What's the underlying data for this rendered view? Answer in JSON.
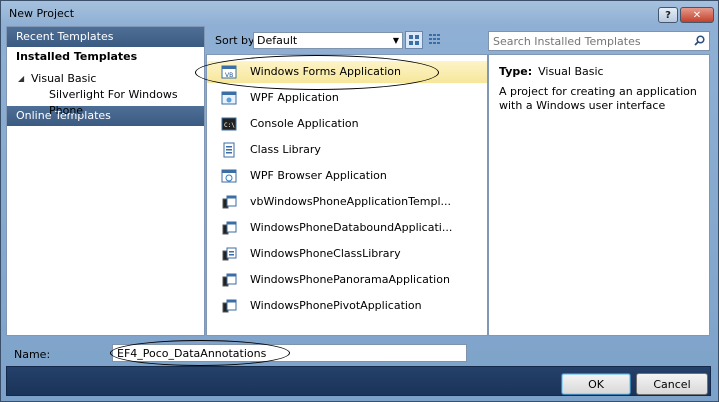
{
  "window": {
    "title": "New Project"
  },
  "left_panel": {
    "recent_label": "Recent Templates",
    "installed_label": "Installed Templates",
    "tree": [
      {
        "label": "Visual Basic",
        "expanded": true
      },
      {
        "label": "Silverlight For Windows Phone"
      }
    ],
    "online_label": "Online Templates"
  },
  "toolbar": {
    "sort_label": "Sort by:",
    "sort_value": "Default"
  },
  "search": {
    "placeholder": "Search Installed Templates"
  },
  "templates": [
    {
      "label": "Windows Forms Application",
      "selected": true
    },
    {
      "label": "WPF Application"
    },
    {
      "label": "Console Application"
    },
    {
      "label": "Class Library"
    },
    {
      "label": "WPF Browser Application"
    },
    {
      "label": "vbWindowsPhoneApplicationTempl..."
    },
    {
      "label": "WindowsPhoneDataboundApplicati..."
    },
    {
      "label": "WindowsPhoneClassLibrary"
    },
    {
      "label": "WindowsPhonePanoramaApplication"
    },
    {
      "label": "WindowsPhonePivotApplication"
    }
  ],
  "details": {
    "type_label": "Type:",
    "type_value": "Visual Basic",
    "description": "A project for creating an application with a Windows user interface"
  },
  "bottom": {
    "name_label": "Name:",
    "name_value": "EF4_Poco_DataAnnotations",
    "ok_label": "OK",
    "cancel_label": "Cancel"
  },
  "colors": {
    "selection": "#f7e79a",
    "header_blue": "#3b5b83",
    "footer_blue": "#1a3358"
  }
}
